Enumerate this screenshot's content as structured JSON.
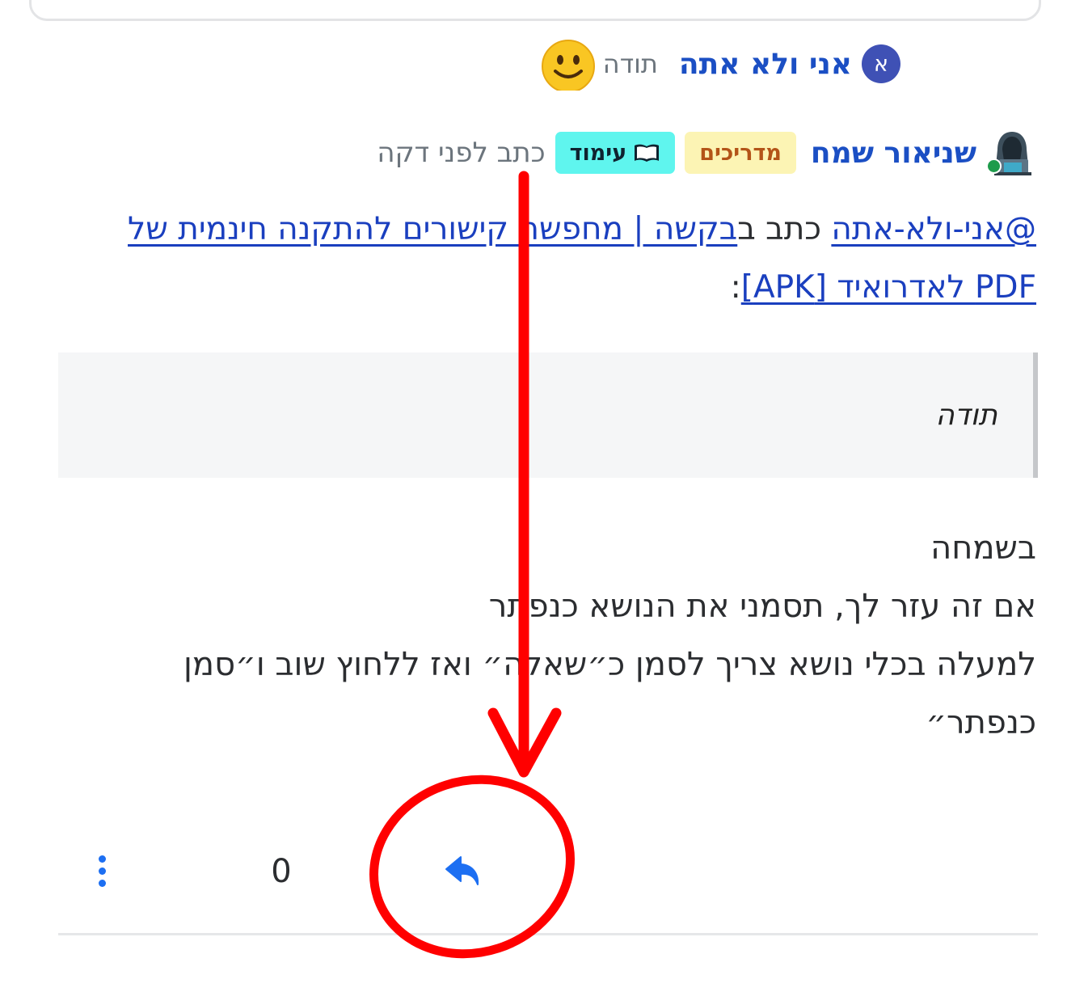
{
  "reaction": {
    "avatar_letter": "א",
    "username": "אני ולא אתה",
    "text": "תודה",
    "emoji": "smiley-emoji"
  },
  "post": {
    "username": "שניאור שמח",
    "badges": {
      "guides": "מדריכים",
      "study": "עימוד"
    },
    "time": "כתב לפני דקה",
    "quote_intro": {
      "mention": "@אני-ולא-אתה",
      "wrote": " כתב ב",
      "topic_link": "בקשה | מחפשת קישורים להתקנה חינמית של PDF לאדרואיד [APK]",
      "colon": ":"
    },
    "quote_text": "תודה",
    "body_lines": [
      "בשמחה",
      "אם זה עזר לך, תסמני את הנושא כנפתר",
      "למעלה בכלי נושא צריך לסמן כ״שאלה״ ואז ללחוץ שוב ו״סמן",
      "כנפתר״"
    ]
  },
  "footer": {
    "votes": "0"
  },
  "icons": {
    "reply": "reply-icon",
    "more": "more-vertical-icon",
    "online": "online-status-icon"
  },
  "colors": {
    "link": "#1b4fc4",
    "action_blue": "#1d6ff2",
    "annotation_red": "#ff0000",
    "badge_study": "#5ff5ee",
    "badge_guides": "#fcf4b4"
  }
}
